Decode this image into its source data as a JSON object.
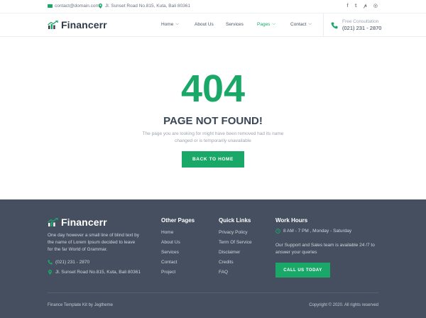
{
  "topbar": {
    "email": "contact@domain.com",
    "address": "Jl. Sunset Road No.815, Kuta, Bali 80361",
    "social_icons": [
      "facebook-icon",
      "twitter-icon",
      "pinterest-icon",
      "instagram-icon"
    ],
    "social_glyphs": [
      "f",
      "𝕥",
      "𝓅",
      "◎"
    ]
  },
  "header": {
    "logo_text": "Financerr",
    "nav": [
      {
        "label": "Home",
        "has_dropdown": true
      },
      {
        "label": "About Us",
        "has_dropdown": false
      },
      {
        "label": "Services",
        "has_dropdown": false
      },
      {
        "label": "Pages",
        "has_dropdown": true,
        "active": true
      },
      {
        "label": "Contact",
        "has_dropdown": true
      }
    ],
    "consult_label": "Free Consultation",
    "consult_phone": "(021) 231 - 2870"
  },
  "main": {
    "code": "404",
    "title": "PAGE NOT FOUND!",
    "description_line1": "The page you are looking for might have been removed had its name",
    "description_line2": "changed or is temporarily unavailable",
    "button": "BACK TO HOME"
  },
  "footer": {
    "logo_text": "Financerr",
    "about_line1": "One day however a small line of blind text by",
    "about_line2": "the name of Lorem Ipsum decided to leave",
    "about_line3": "for the far World of Grammar.",
    "phone": "(021) 231 - 2870",
    "address": "Jl. Sunset Road No.815, Kuta, Bali 80361",
    "other_pages": {
      "heading": "Other Pages",
      "links": [
        "Home",
        "About Us",
        "Services",
        "Contact",
        "Project"
      ]
    },
    "quick_links": {
      "heading": "Quick Links",
      "links": [
        "Privacy Policy",
        "Term Of Service",
        "Disclaimer",
        "Credits",
        "FAQ"
      ]
    },
    "work_hours": {
      "heading": "Work Hours",
      "hours": "8 AM - 7 PM , Monday - Saturday",
      "support_line1": "Our Support and Sales team is available 24 /7 to",
      "support_line2": "answer your queries",
      "button": "CALL US TODAY"
    },
    "credit": "Finance Template Kit by Jegtheme",
    "copyright": "Copyright © 2020. All rights reserved"
  },
  "colors": {
    "accent": "#1aa868",
    "footer_bg": "#454f60",
    "heading": "#3a4555"
  }
}
